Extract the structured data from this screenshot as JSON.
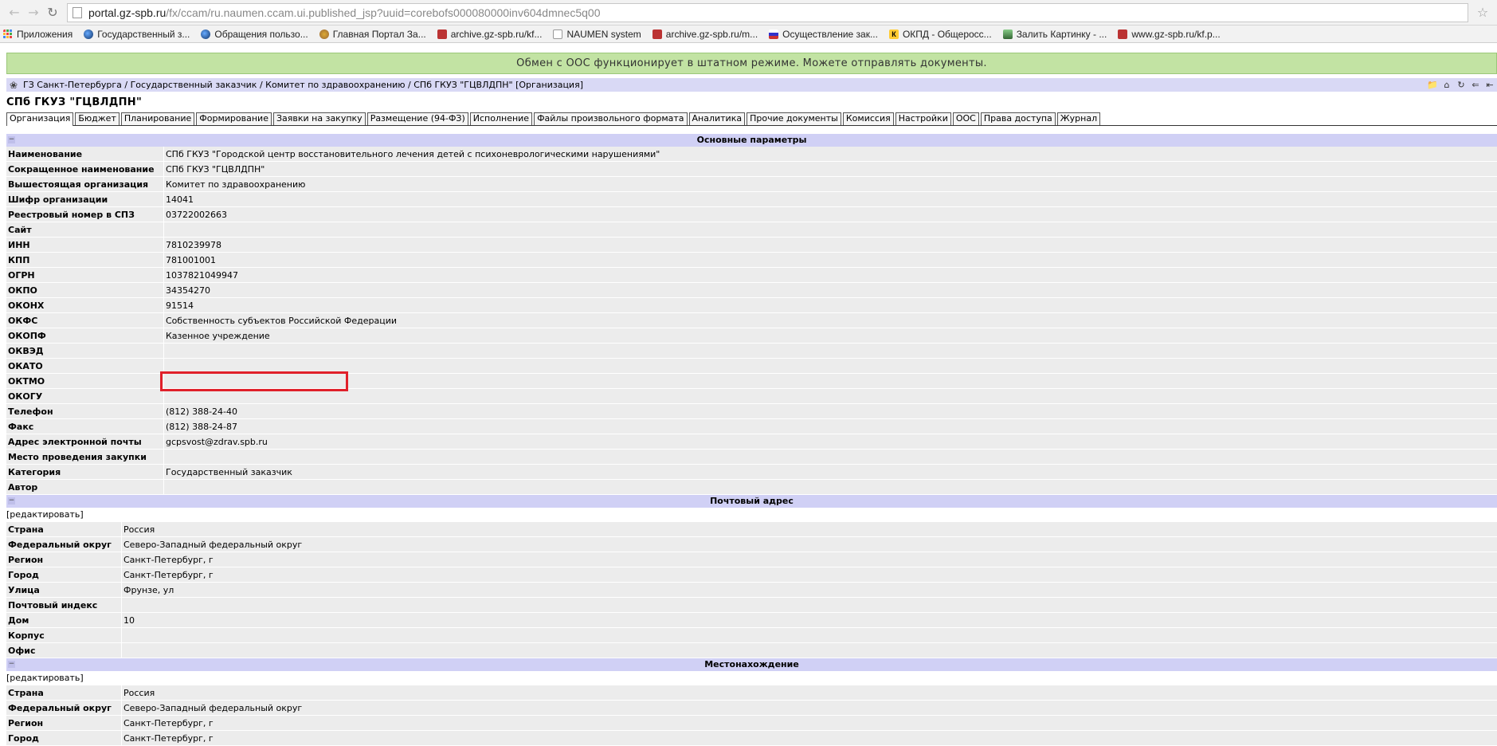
{
  "browser": {
    "url_host": "portal.gz-spb.ru",
    "url_path": "/fx/ccam/ru.naumen.ccam.ui.published_jsp?uuid=corebofs000080000inv604dmnec5q00",
    "bookmarks": [
      {
        "label": "Приложения",
        "icon": "apps-grid-icon"
      },
      {
        "label": "Государственный з...",
        "icon": "globe-icon"
      },
      {
        "label": "Обращения пользо...",
        "icon": "globe-icon"
      },
      {
        "label": "Главная Портал За...",
        "icon": "gov-emblem-icon"
      },
      {
        "label": "archive.gz-spb.ru/kf...",
        "icon": "crest-icon"
      },
      {
        "label": "NAUMEN system",
        "icon": "document-icon"
      },
      {
        "label": "archive.gz-spb.ru/m...",
        "icon": "crest-icon"
      },
      {
        "label": "Осуществление зак...",
        "icon": "flag-icon"
      },
      {
        "label": "ОКПД - Общеросс...",
        "icon": "k-badge-icon"
      },
      {
        "label": "Залить Картинку - ...",
        "icon": "image-icon"
      },
      {
        "label": "www.gz-spb.ru/kf.p...",
        "icon": "crest-icon"
      }
    ]
  },
  "status_banner": "Обмен с ООС функционирует в штатном режиме. Можете отправлять документы.",
  "breadcrumb": "ГЗ Санкт-Петербурга / Государственный заказчик / Комитет по здравоохранению / СПб ГКУЗ \"ГЦВЛДПН\" [Организация]",
  "org_title": "СПб ГКУЗ \"ГЦВЛДПН\"",
  "tabs": [
    "Организация",
    "Бюджет",
    "Планирование",
    "Формирование",
    "Заявки на закупку",
    "Размещение (94-ФЗ)",
    "Исполнение",
    "Файлы произвольного формата",
    "Аналитика",
    "Прочие документы",
    "Комиссия",
    "Настройки",
    "ООС",
    "Права доступа",
    "Журнал"
  ],
  "active_tab": "Организация",
  "main_section": {
    "title": "Основные параметры",
    "rows": [
      {
        "label": "Наименование",
        "value": "СПб ГКУЗ \"Городской центр восстановительного лечения детей с психоневрологическими нарушениями\""
      },
      {
        "label": "Сокращенное наименование",
        "value": "СПб ГКУЗ \"ГЦВЛДПН\""
      },
      {
        "label": "Вышестоящая организация",
        "value": "Комитет по здравоохранению"
      },
      {
        "label": "Шифр организации",
        "value": "14041"
      },
      {
        "label": "Реестровый номер в СПЗ",
        "value": "03722002663"
      },
      {
        "label": "Сайт",
        "value": ""
      },
      {
        "label": "ИНН",
        "value": "7810239978"
      },
      {
        "label": "КПП",
        "value": "781001001"
      },
      {
        "label": "ОГРН",
        "value": "1037821049947"
      },
      {
        "label": "ОКПО",
        "value": "34354270"
      },
      {
        "label": "ОКОНХ",
        "value": "91514"
      },
      {
        "label": "ОКФС",
        "value": "Собственность субъектов Российской Федерации"
      },
      {
        "label": "ОКОПФ",
        "value": "Казенное учреждение"
      },
      {
        "label": "ОКВЭД",
        "value": ""
      },
      {
        "label": "ОКАТО",
        "value": ""
      },
      {
        "label": "ОКТМО",
        "value": ""
      },
      {
        "label": "ОКОГУ",
        "value": ""
      },
      {
        "label": "Телефон",
        "value": "(812) 388-24-40"
      },
      {
        "label": "Факс",
        "value": "(812) 388-24-87"
      },
      {
        "label": "Адрес электронной почты",
        "value": "gcpsvost@zdrav.spb.ru"
      },
      {
        "label": "Место проведения закупки",
        "value": ""
      },
      {
        "label": "Категория",
        "value": "Государственный заказчик"
      },
      {
        "label": "Автор",
        "value": ""
      }
    ]
  },
  "postal_section": {
    "title": "Почтовый адрес",
    "edit_label": "[редактировать]",
    "rows": [
      {
        "label": "Страна",
        "value": "Россия"
      },
      {
        "label": "Федеральный округ",
        "value": "Северо-Западный федеральный округ"
      },
      {
        "label": "Регион",
        "value": "Санкт-Петербург, г"
      },
      {
        "label": "Город",
        "value": "Санкт-Петербург, г"
      },
      {
        "label": "Улица",
        "value": "Фрунзе, ул"
      },
      {
        "label": "Почтовый индекс",
        "value": ""
      },
      {
        "label": "Дом",
        "value": "10"
      },
      {
        "label": "Корпус",
        "value": ""
      },
      {
        "label": "Офис",
        "value": ""
      }
    ]
  },
  "location_section": {
    "title": "Местонахождение",
    "edit_label": "[редактировать]",
    "rows": [
      {
        "label": "Страна",
        "value": "Россия"
      },
      {
        "label": "Федеральный округ",
        "value": "Северо-Западный федеральный округ"
      },
      {
        "label": "Регион",
        "value": "Санкт-Петербург, г"
      },
      {
        "label": "Город",
        "value": "Санкт-Петербург, г"
      }
    ]
  },
  "highlight_color": "#e0202a",
  "banner_color": "#c2e3a3",
  "header_color": "#d0d0f5"
}
